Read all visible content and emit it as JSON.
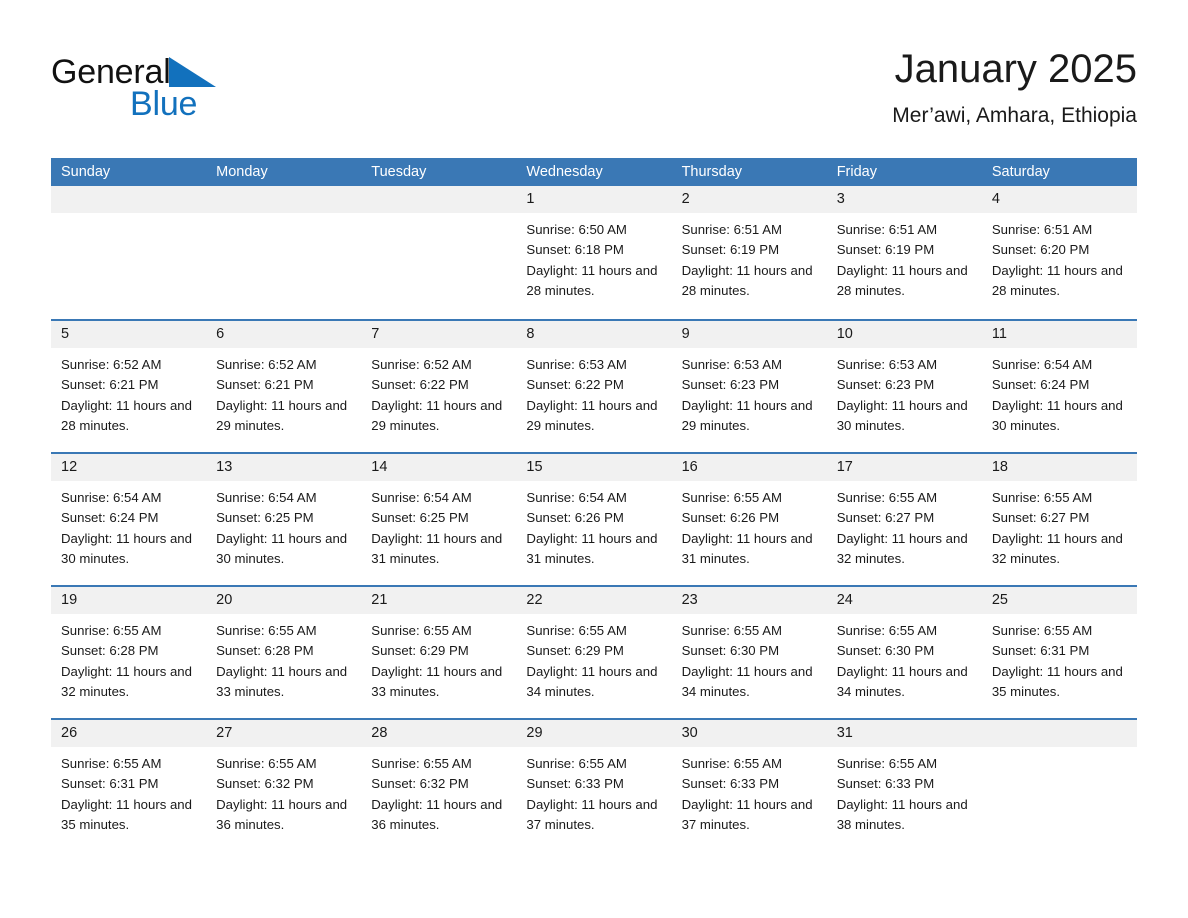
{
  "brand": {
    "word1": "General",
    "word2": "Blue",
    "triangle_color": "#1271bd"
  },
  "header": {
    "title": "January 2025",
    "subtitle": "Mer’awi, Amhara, Ethiopia"
  },
  "theme": {
    "header_blue": "#3a78b5",
    "day_head_gray": "#f1f1f1",
    "text": "#1a1a1a"
  },
  "weekdays": [
    "Sunday",
    "Monday",
    "Tuesday",
    "Wednesday",
    "Thursday",
    "Friday",
    "Saturday"
  ],
  "weeks": [
    [
      {
        "day": "",
        "sunrise": "",
        "sunset": "",
        "daylight": ""
      },
      {
        "day": "",
        "sunrise": "",
        "sunset": "",
        "daylight": ""
      },
      {
        "day": "",
        "sunrise": "",
        "sunset": "",
        "daylight": ""
      },
      {
        "day": "1",
        "sunrise": "Sunrise: 6:50 AM",
        "sunset": "Sunset: 6:18 PM",
        "daylight": "Daylight: 11 hours and 28 minutes."
      },
      {
        "day": "2",
        "sunrise": "Sunrise: 6:51 AM",
        "sunset": "Sunset: 6:19 PM",
        "daylight": "Daylight: 11 hours and 28 minutes."
      },
      {
        "day": "3",
        "sunrise": "Sunrise: 6:51 AM",
        "sunset": "Sunset: 6:19 PM",
        "daylight": "Daylight: 11 hours and 28 minutes."
      },
      {
        "day": "4",
        "sunrise": "Sunrise: 6:51 AM",
        "sunset": "Sunset: 6:20 PM",
        "daylight": "Daylight: 11 hours and 28 minutes."
      }
    ],
    [
      {
        "day": "5",
        "sunrise": "Sunrise: 6:52 AM",
        "sunset": "Sunset: 6:21 PM",
        "daylight": "Daylight: 11 hours and 28 minutes."
      },
      {
        "day": "6",
        "sunrise": "Sunrise: 6:52 AM",
        "sunset": "Sunset: 6:21 PM",
        "daylight": "Daylight: 11 hours and 29 minutes."
      },
      {
        "day": "7",
        "sunrise": "Sunrise: 6:52 AM",
        "sunset": "Sunset: 6:22 PM",
        "daylight": "Daylight: 11 hours and 29 minutes."
      },
      {
        "day": "8",
        "sunrise": "Sunrise: 6:53 AM",
        "sunset": "Sunset: 6:22 PM",
        "daylight": "Daylight: 11 hours and 29 minutes."
      },
      {
        "day": "9",
        "sunrise": "Sunrise: 6:53 AM",
        "sunset": "Sunset: 6:23 PM",
        "daylight": "Daylight: 11 hours and 29 minutes."
      },
      {
        "day": "10",
        "sunrise": "Sunrise: 6:53 AM",
        "sunset": "Sunset: 6:23 PM",
        "daylight": "Daylight: 11 hours and 30 minutes."
      },
      {
        "day": "11",
        "sunrise": "Sunrise: 6:54 AM",
        "sunset": "Sunset: 6:24 PM",
        "daylight": "Daylight: 11 hours and 30 minutes."
      }
    ],
    [
      {
        "day": "12",
        "sunrise": "Sunrise: 6:54 AM",
        "sunset": "Sunset: 6:24 PM",
        "daylight": "Daylight: 11 hours and 30 minutes."
      },
      {
        "day": "13",
        "sunrise": "Sunrise: 6:54 AM",
        "sunset": "Sunset: 6:25 PM",
        "daylight": "Daylight: 11 hours and 30 minutes."
      },
      {
        "day": "14",
        "sunrise": "Sunrise: 6:54 AM",
        "sunset": "Sunset: 6:25 PM",
        "daylight": "Daylight: 11 hours and 31 minutes."
      },
      {
        "day": "15",
        "sunrise": "Sunrise: 6:54 AM",
        "sunset": "Sunset: 6:26 PM",
        "daylight": "Daylight: 11 hours and 31 minutes."
      },
      {
        "day": "16",
        "sunrise": "Sunrise: 6:55 AM",
        "sunset": "Sunset: 6:26 PM",
        "daylight": "Daylight: 11 hours and 31 minutes."
      },
      {
        "day": "17",
        "sunrise": "Sunrise: 6:55 AM",
        "sunset": "Sunset: 6:27 PM",
        "daylight": "Daylight: 11 hours and 32 minutes."
      },
      {
        "day": "18",
        "sunrise": "Sunrise: 6:55 AM",
        "sunset": "Sunset: 6:27 PM",
        "daylight": "Daylight: 11 hours and 32 minutes."
      }
    ],
    [
      {
        "day": "19",
        "sunrise": "Sunrise: 6:55 AM",
        "sunset": "Sunset: 6:28 PM",
        "daylight": "Daylight: 11 hours and 32 minutes."
      },
      {
        "day": "20",
        "sunrise": "Sunrise: 6:55 AM",
        "sunset": "Sunset: 6:28 PM",
        "daylight": "Daylight: 11 hours and 33 minutes."
      },
      {
        "day": "21",
        "sunrise": "Sunrise: 6:55 AM",
        "sunset": "Sunset: 6:29 PM",
        "daylight": "Daylight: 11 hours and 33 minutes."
      },
      {
        "day": "22",
        "sunrise": "Sunrise: 6:55 AM",
        "sunset": "Sunset: 6:29 PM",
        "daylight": "Daylight: 11 hours and 34 minutes."
      },
      {
        "day": "23",
        "sunrise": "Sunrise: 6:55 AM",
        "sunset": "Sunset: 6:30 PM",
        "daylight": "Daylight: 11 hours and 34 minutes."
      },
      {
        "day": "24",
        "sunrise": "Sunrise: 6:55 AM",
        "sunset": "Sunset: 6:30 PM",
        "daylight": "Daylight: 11 hours and 34 minutes."
      },
      {
        "day": "25",
        "sunrise": "Sunrise: 6:55 AM",
        "sunset": "Sunset: 6:31 PM",
        "daylight": "Daylight: 11 hours and 35 minutes."
      }
    ],
    [
      {
        "day": "26",
        "sunrise": "Sunrise: 6:55 AM",
        "sunset": "Sunset: 6:31 PM",
        "daylight": "Daylight: 11 hours and 35 minutes."
      },
      {
        "day": "27",
        "sunrise": "Sunrise: 6:55 AM",
        "sunset": "Sunset: 6:32 PM",
        "daylight": "Daylight: 11 hours and 36 minutes."
      },
      {
        "day": "28",
        "sunrise": "Sunrise: 6:55 AM",
        "sunset": "Sunset: 6:32 PM",
        "daylight": "Daylight: 11 hours and 36 minutes."
      },
      {
        "day": "29",
        "sunrise": "Sunrise: 6:55 AM",
        "sunset": "Sunset: 6:33 PM",
        "daylight": "Daylight: 11 hours and 37 minutes."
      },
      {
        "day": "30",
        "sunrise": "Sunrise: 6:55 AM",
        "sunset": "Sunset: 6:33 PM",
        "daylight": "Daylight: 11 hours and 37 minutes."
      },
      {
        "day": "31",
        "sunrise": "Sunrise: 6:55 AM",
        "sunset": "Sunset: 6:33 PM",
        "daylight": "Daylight: 11 hours and 38 minutes."
      },
      {
        "day": "",
        "sunrise": "",
        "sunset": "",
        "daylight": ""
      }
    ]
  ]
}
